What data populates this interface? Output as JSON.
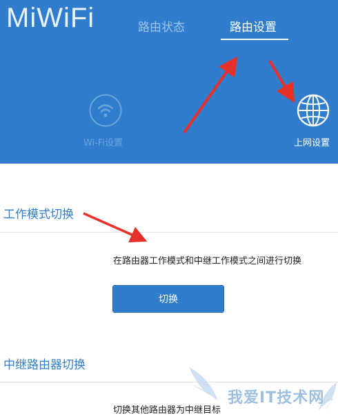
{
  "header": {
    "logo": "MiWiFi",
    "tabs": [
      {
        "label": "路由状态",
        "active": false
      },
      {
        "label": "路由设置",
        "active": true
      }
    ],
    "tiles": [
      {
        "label": "Wi-Fi设置",
        "icon": "wifi-icon",
        "enabled": false
      },
      {
        "label": "上网设置",
        "icon": "globe-icon",
        "enabled": true
      }
    ]
  },
  "sections": [
    {
      "title": "工作模式切换",
      "description": "在路由器工作模式和中继工作模式之间进行切换",
      "button_label": "切换"
    },
    {
      "title": "中继路由器切换",
      "description": "切换其他路由器为中继目标"
    }
  ],
  "annotation_arrows": {
    "color": "#e8302a",
    "count": 3
  },
  "watermark": {
    "text": "我爱IT技术网"
  },
  "colors": {
    "header_bg": "#2f7dcc",
    "accent": "#2f7dcc",
    "active_tab": "#ffffff",
    "inactive_tab": "#9fc2ea"
  }
}
